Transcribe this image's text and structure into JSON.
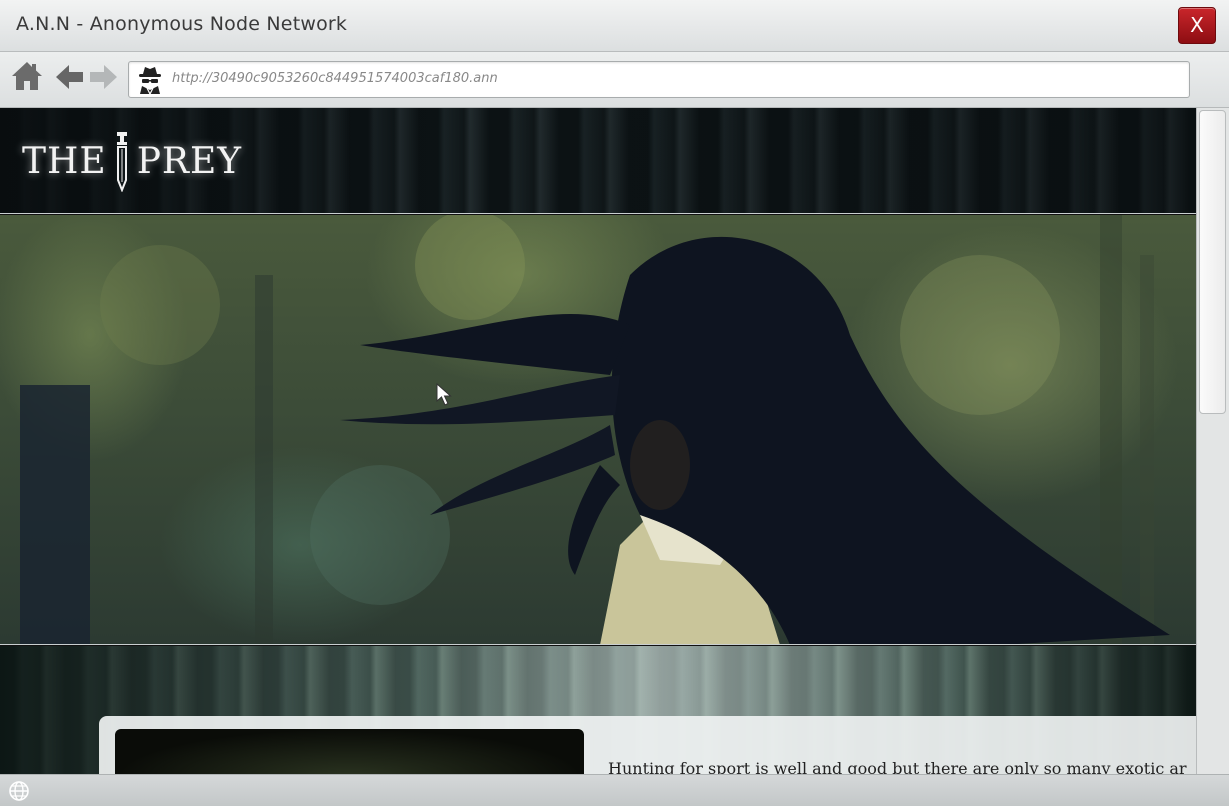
{
  "window": {
    "title": "A.N.N - Anonymous Node Network",
    "close_label": "X"
  },
  "toolbar": {
    "home_icon": "home-icon",
    "back_icon": "back-arrow-icon",
    "forward_icon": "forward-arrow-icon",
    "address_icon": "spy-icon",
    "url": "http://30490c9053260c844951574003caf180.ann"
  },
  "site": {
    "logo_left": "THE",
    "logo_right": "PREY",
    "logo_icon": "dagger-icon",
    "content_text": "Hunting for sport is well and good but there are only so many exotic ar"
  },
  "statusbar": {
    "icon": "globe-icon"
  },
  "colors": {
    "close_button": "#b5161c",
    "titlebar": "#e6e8e9",
    "page_dark": "#111111"
  }
}
